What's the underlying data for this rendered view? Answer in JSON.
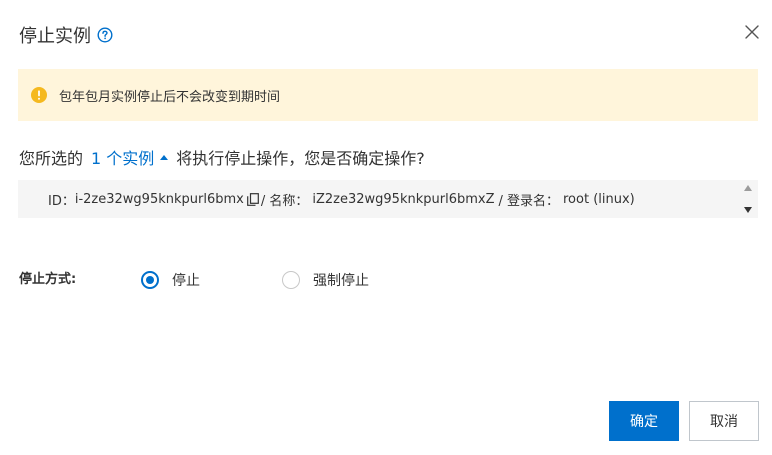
{
  "dialog": {
    "title": "停止实例"
  },
  "warning": {
    "text": "包年包月实例停止后不会改变到期时间"
  },
  "confirm": {
    "prefix": "您所选的",
    "link": "1 个实例",
    "suffix": "将执行停止操作，您是否确定操作?"
  },
  "instance": {
    "id_label": "ID：",
    "id_value": "i-2ze32wg95knkpurl6bmx",
    "name_label": "/ 名称：",
    "name_value": "iZ2ze32wg95knkpurl6bmxZ",
    "login_label": "/ 登录名：",
    "login_value": "root (linux)"
  },
  "stop_mode": {
    "label": "停止方式:",
    "options": [
      {
        "label": "停止",
        "selected": true
      },
      {
        "label": "强制停止",
        "selected": false
      }
    ]
  },
  "footer": {
    "confirm_label": "确定",
    "cancel_label": "取消"
  },
  "icons": {
    "help": "help-circle-icon",
    "close": "close-icon",
    "warning": "warning-icon",
    "copy": "copy-icon"
  },
  "colors": {
    "primary": "#0070cc",
    "warning_bg": "#fff5db",
    "warning_icon": "#f5b91f",
    "instance_bg": "#f5f5f5"
  }
}
